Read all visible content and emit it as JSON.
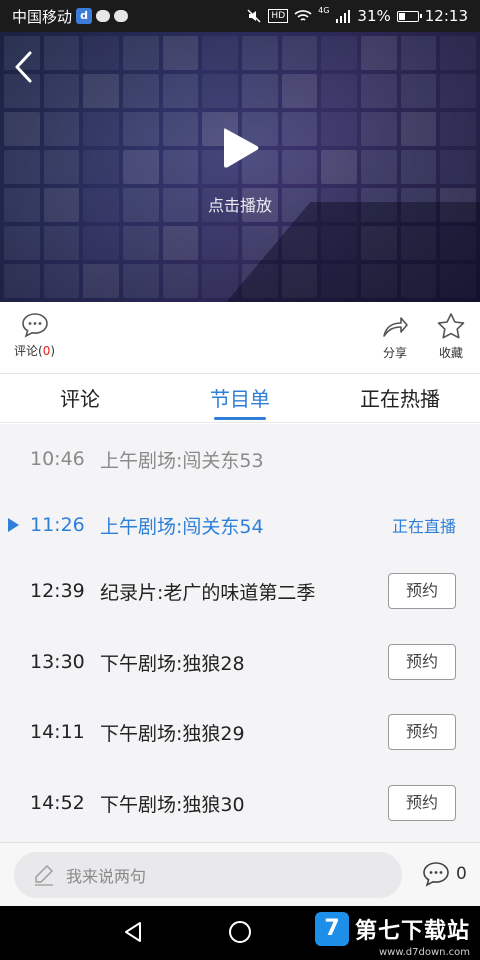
{
  "status_bar": {
    "carrier": "中国移动",
    "carrier_badge": "d",
    "network": "4G",
    "battery": "31%",
    "battery_level": 0.31,
    "time": "12:13",
    "hd": "HD"
  },
  "player": {
    "play_label": "点击播放",
    "icons": {
      "back": "back-arrow-icon",
      "play": "play-icon"
    }
  },
  "actions": {
    "comment_label": "评论(",
    "comment_count": "0",
    "comment_close": ")",
    "share_label": "分享",
    "favorite_label": "收藏"
  },
  "tabs": [
    {
      "label": "评论"
    },
    {
      "label": "节目单"
    },
    {
      "label": "正在热播"
    }
  ],
  "active_tab": "节目单",
  "schedule": {
    "live_label": "正在直播",
    "reserve_label": "预约",
    "items": [
      {
        "time": "10:46",
        "title": "上午剧场:闯关东53",
        "state": "past"
      },
      {
        "time": "11:26",
        "title": "上午剧场:闯关东54",
        "state": "live"
      },
      {
        "time": "12:39",
        "title": "纪录片:老广的味道第二季",
        "state": "upcoming"
      },
      {
        "time": "13:30",
        "title": "下午剧场:独狼28",
        "state": "upcoming"
      },
      {
        "time": "14:11",
        "title": "下午剧场:独狼29",
        "state": "upcoming"
      },
      {
        "time": "14:52",
        "title": "下午剧场:独狼30",
        "state": "upcoming"
      }
    ]
  },
  "comment_bar": {
    "placeholder": "我来说两句",
    "count": "0"
  },
  "watermark": {
    "logo": "7",
    "text": "第七下载站",
    "url": "www.d7down.com"
  },
  "colors": {
    "accent": "#2d7fd8",
    "count_red": "#e02020",
    "status_bg": "#1b1b1b",
    "nav_bg": "#000000"
  }
}
